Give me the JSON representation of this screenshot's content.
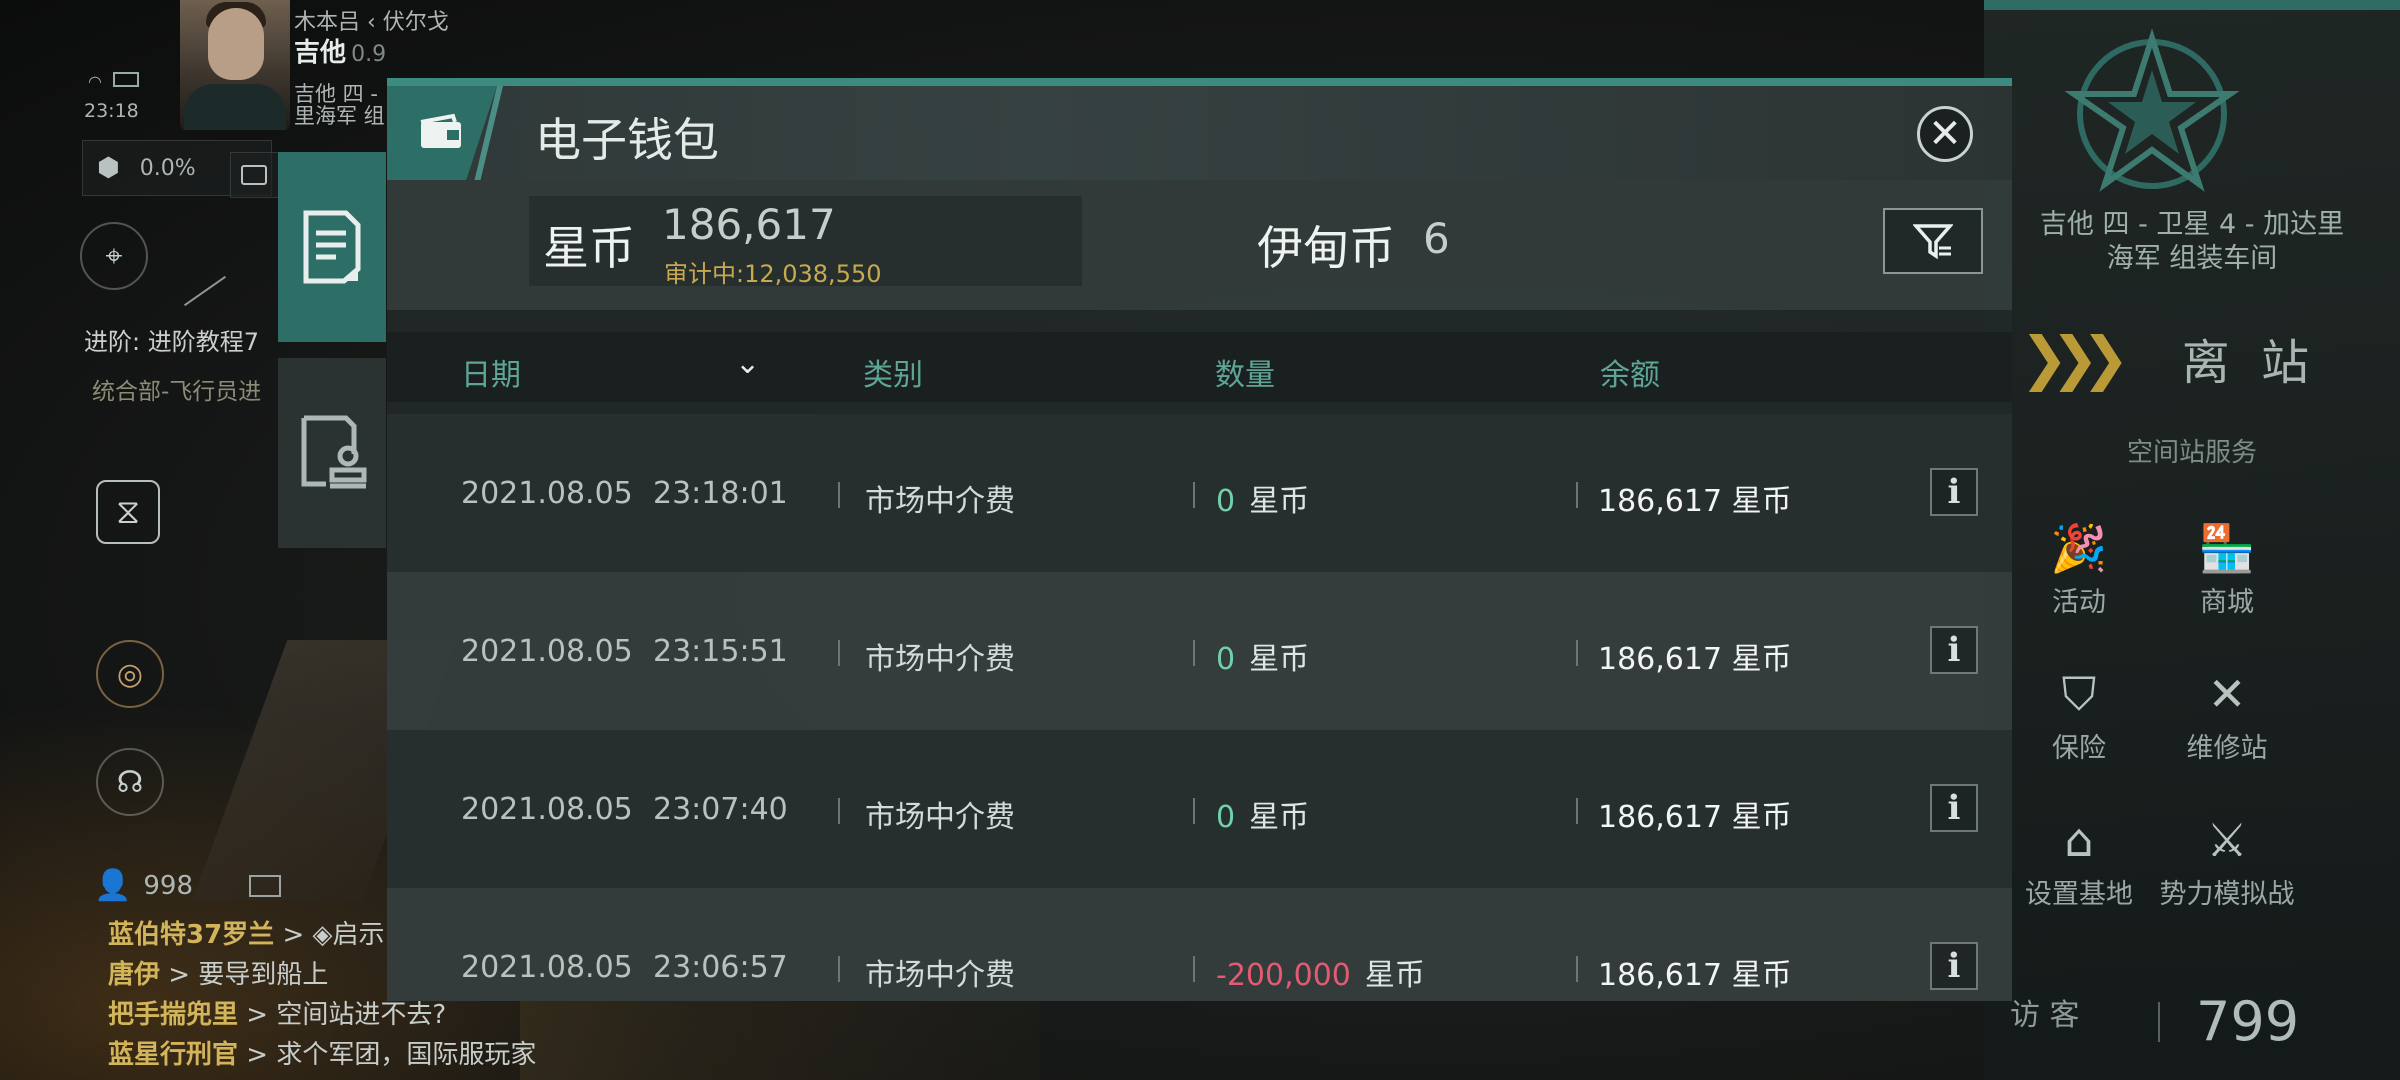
{
  "hud": {
    "location_top": "木本吕  ‹ 伏尔戈",
    "pilot_name": "吉他",
    "security": "0.9",
    "location_line1": "吉他 四 -",
    "location_line2": "里海军 组",
    "clock": "23:18",
    "cargo_percent": "0.0%",
    "task_title": "进阶: 进阶教程7",
    "task_sub": "统合部-飞行员进",
    "online_count": "998"
  },
  "chat": [
    {
      "name": "蓝伯特37罗兰",
      "msg": " > ◈启示"
    },
    {
      "name": "唐伊",
      "msg": " > 要导到船上"
    },
    {
      "name": "把手揣兜里",
      "msg": " > 空间站进不去?"
    },
    {
      "name": "蓝星行刑官",
      "msg": " > 求个军团，国际服玩家"
    }
  ],
  "station": {
    "name_line1": "吉他 四 - 卫星 4 - 加达里",
    "name_line2": "海军 组装车间",
    "depart_label": "离 站",
    "services_title": "空间站服务",
    "services": [
      {
        "label": "活动",
        "icon": "party-popper-icon"
      },
      {
        "label": "商城",
        "icon": "shop-icon"
      },
      {
        "label": "保险",
        "icon": "insurance-icon"
      },
      {
        "label": "维修站",
        "icon": "repair-wrench-icon"
      },
      {
        "label": "设置基地",
        "icon": "home-base-icon"
      },
      {
        "label": "势力模拟战",
        "icon": "crossed-flags-icon"
      }
    ],
    "visitor_label": "访 客",
    "visitor_count": "799"
  },
  "wallet": {
    "title": "电子钱包",
    "star_coin_label": "星币",
    "star_coin_value": "186,617",
    "star_coin_pending": "审计中:12,038,550",
    "isk_label": "伊甸币",
    "isk_value": "6",
    "columns": {
      "date": "日期",
      "category": "类别",
      "amount": "数量",
      "balance": "余额"
    },
    "rows": [
      {
        "date": "2021.08.05",
        "time": "23:18:01",
        "category": "市场中介费",
        "amount": "0",
        "amount_sign": "pos",
        "unit": "星币",
        "balance": "186,617 星币"
      },
      {
        "date": "2021.08.05",
        "time": "23:15:51",
        "category": "市场中介费",
        "amount": "0",
        "amount_sign": "pos",
        "unit": "星币",
        "balance": "186,617 星币"
      },
      {
        "date": "2021.08.05",
        "time": "23:07:40",
        "category": "市场中介费",
        "amount": "0",
        "amount_sign": "pos",
        "unit": "星币",
        "balance": "186,617 星币"
      },
      {
        "date": "2021.08.05",
        "time": "23:06:57",
        "category": "市场中介费",
        "amount": "-200,000",
        "amount_sign": "neg",
        "unit": "星币",
        "balance": "186,617 星币"
      }
    ]
  },
  "colors": {
    "accent_teal": "#2d6e66",
    "header_text_teal": "#5fa596",
    "positive_green": "#6fd0a9",
    "negative_red": "#e25b73",
    "pending_gold": "#c7a94f",
    "depart_gold": "#b99a37"
  }
}
